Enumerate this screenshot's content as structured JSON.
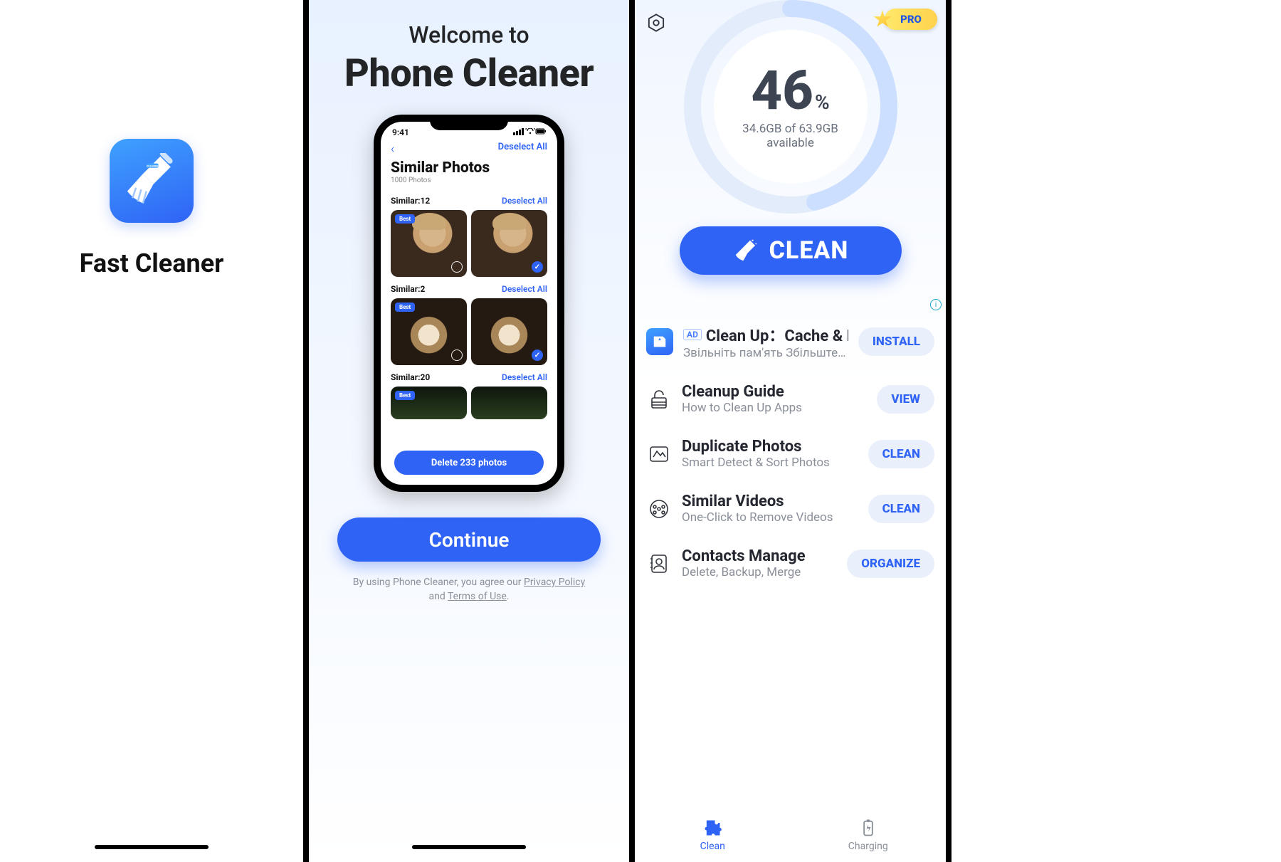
{
  "panel1": {
    "app_name": "Fast Cleaner"
  },
  "panel2": {
    "welcome": "Welcome to",
    "app_name": "Phone Cleaner",
    "mock": {
      "time": "9:41",
      "deselect_all": "Deselect All",
      "title": "Similar Photos",
      "subtitle": "1000 Photos",
      "groups": [
        {
          "name": "Similar:12",
          "deselect": "Deselect All",
          "best": "Best"
        },
        {
          "name": "Similar:2",
          "deselect": "Deselect All",
          "best": "Best"
        },
        {
          "name": "Similar:20",
          "deselect": "Deselect All",
          "best": "Best"
        }
      ],
      "delete_btn": "Delete 233 photos"
    },
    "continue": "Continue",
    "agree_pre": "By using Phone Cleaner, you agree our ",
    "privacy": "Privacy Policy",
    "agree_and": " and ",
    "terms": "Terms of Use",
    "agree_end": "."
  },
  "panel3": {
    "pro": "PRO",
    "pct_value": "46",
    "pct_symbol": "%",
    "storage_line1": "34.6GB of 63.9GB",
    "storage_line2": "available",
    "clean_btn": "CLEAN",
    "ad": {
      "badge": "AD",
      "title": "Clean Up：Cache & D…",
      "subtitle": "Звільніть пам'ять Збільште о…",
      "action": "INSTALL"
    },
    "items": [
      {
        "title": "Cleanup Guide",
        "subtitle": "How to Clean Up Apps",
        "action": "VIEW"
      },
      {
        "title": "Duplicate Photos",
        "subtitle": "Smart Detect & Sort Photos",
        "action": "CLEAN"
      },
      {
        "title": "Similar Videos",
        "subtitle": "One-Click to Remove Videos",
        "action": "CLEAN"
      },
      {
        "title": "Contacts Manage",
        "subtitle": "Delete, Backup, Merge",
        "action": "ORGANIZE"
      }
    ],
    "tabs": {
      "clean": "Clean",
      "charging": "Charging"
    }
  }
}
